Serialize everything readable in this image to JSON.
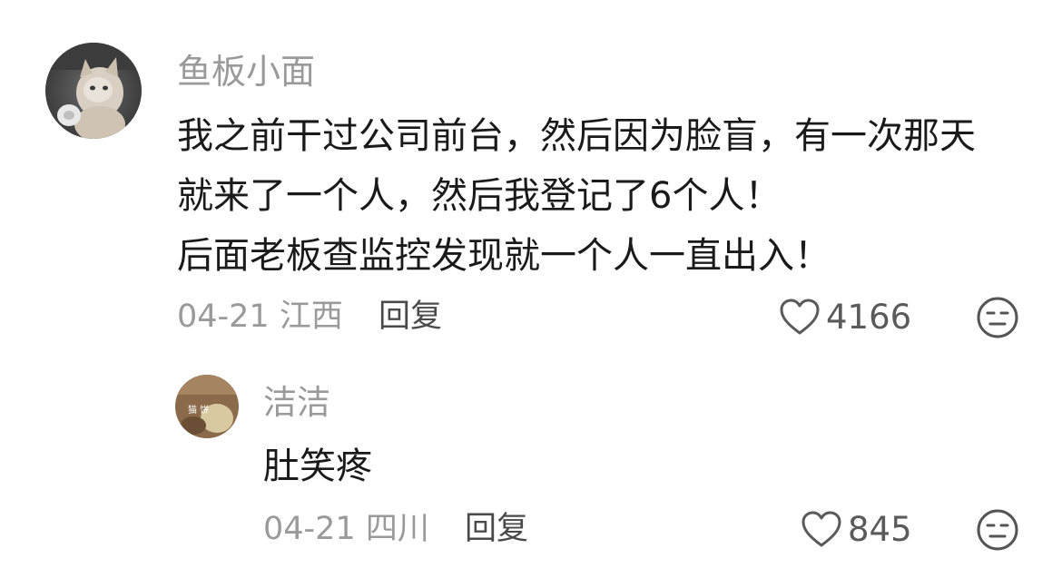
{
  "comments": [
    {
      "username": "鱼板小面",
      "lines": [
        "我之前干过公司前台，然后因为脸盲，有一次那天",
        "就来了一个人，然后我登记了6个人！",
        "后面老板查监控发现就一个人一直出入！"
      ],
      "date": "04-21",
      "location": "江西",
      "reply_label": "回复",
      "like_count": "4166"
    }
  ],
  "replies": [
    {
      "username": "洁洁",
      "avatar_text": "猫 饼",
      "text": "肚笑疼",
      "date": "04-21",
      "location": "四川",
      "reply_label": "回复",
      "like_count": "845"
    }
  ]
}
